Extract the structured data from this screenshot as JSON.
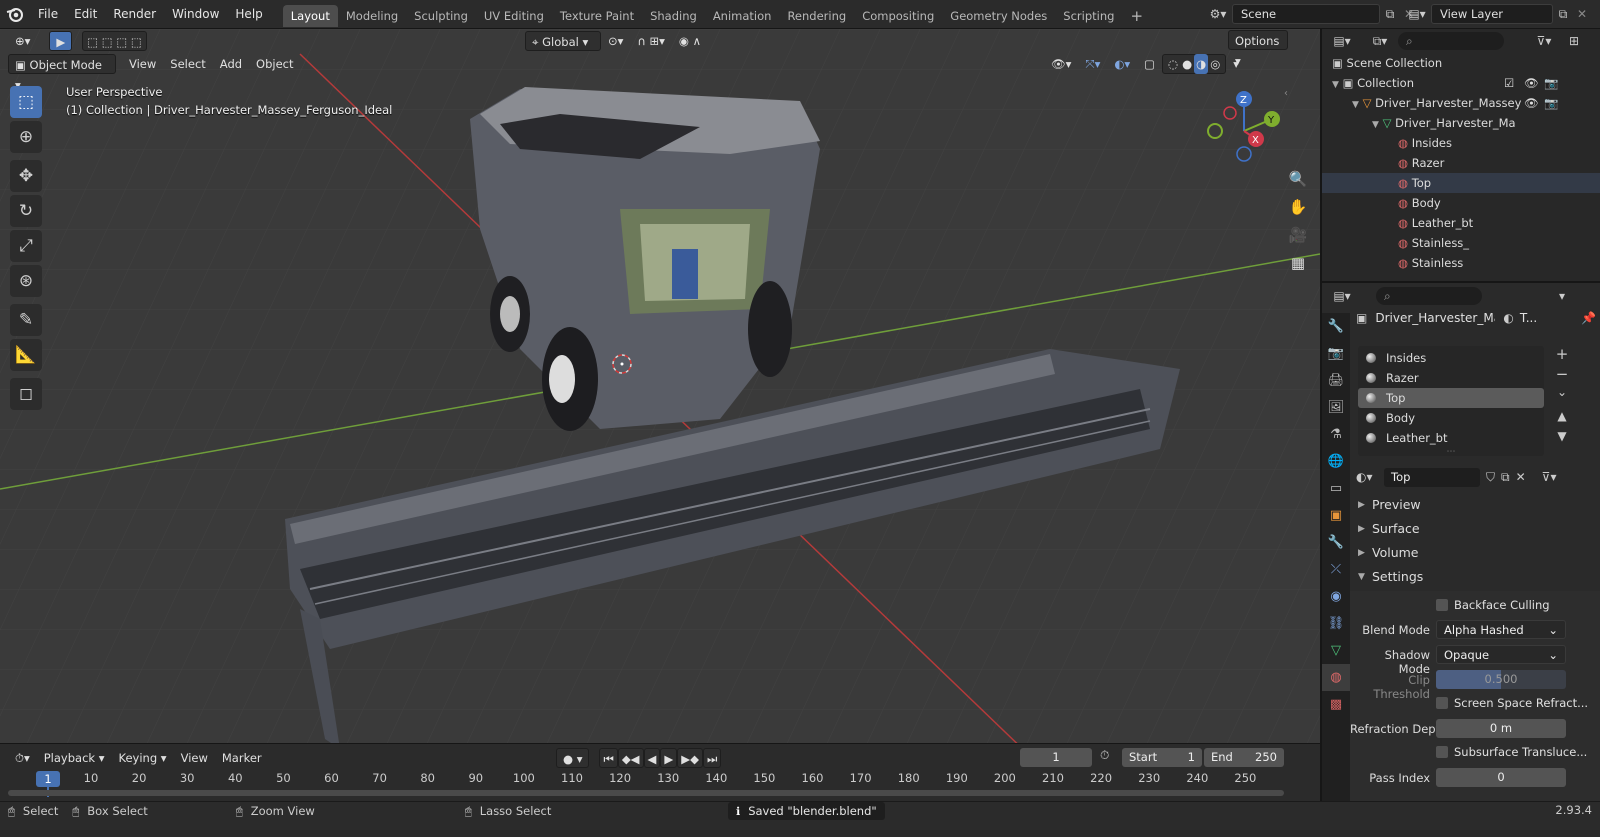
{
  "topbar": {
    "menus": [
      "File",
      "Edit",
      "Render",
      "Window",
      "Help"
    ],
    "workspaces": [
      "Layout",
      "Modeling",
      "Sculpting",
      "UV Editing",
      "Texture Paint",
      "Shading",
      "Animation",
      "Rendering",
      "Compositing",
      "Geometry Nodes",
      "Scripting"
    ],
    "active_workspace": "Layout",
    "scene": "Scene",
    "view_layer": "View Layer"
  },
  "viewport": {
    "mode": "Object Mode",
    "menus": [
      "View",
      "Select",
      "Add",
      "Object"
    ],
    "transform_orientation": "Global",
    "options_label": "Options",
    "perspective_label": "User Perspective",
    "collection_label": "(1) Collection | Driver_Harvester_Massey_Ferguson_Ideal",
    "gizmo": {
      "z": "Z",
      "y": "Y",
      "x": "X"
    }
  },
  "outliner": {
    "rows": [
      {
        "label": "Scene Collection",
        "indent": 0
      },
      {
        "label": "Collection",
        "indent": 1
      },
      {
        "label": "Driver_Harvester_Massey",
        "indent": 2
      },
      {
        "label": "Driver_Harvester_Ma",
        "indent": 3
      },
      {
        "label": "Insides",
        "indent": 4
      },
      {
        "label": "Razer",
        "indent": 4
      },
      {
        "label": "Top",
        "indent": 4
      },
      {
        "label": "Body",
        "indent": 4
      },
      {
        "label": "Leather_bt",
        "indent": 4
      },
      {
        "label": "Stainless_",
        "indent": 4
      },
      {
        "label": "Stainless",
        "indent": 4
      }
    ]
  },
  "properties": {
    "object_name": "Driver_Harvester_Ma...",
    "material_short": "T...",
    "material_slots": [
      "Insides",
      "Razer",
      "Top",
      "Body",
      "Leather_bt"
    ],
    "selected_slot": "Top",
    "material_name": "Top",
    "panels": [
      "Preview",
      "Surface",
      "Volume",
      "Settings"
    ],
    "settings": {
      "backface_culling": "Backface Culling",
      "blend_mode_label": "Blend Mode",
      "blend_mode_value": "Alpha Hashed",
      "shadow_mode_label": "Shadow Mode",
      "shadow_mode_value": "Opaque",
      "clip_threshold_label": "Clip Threshold",
      "clip_threshold_value": "0.500",
      "ssr_label": "Screen Space Refract...",
      "refraction_depth_label": "Refraction Depth",
      "refraction_depth_value": "0 m",
      "subsurface_label": "Subsurface Translucе...",
      "pass_index_label": "Pass Index",
      "pass_index_value": "0"
    }
  },
  "timeline": {
    "menus": [
      "Playback",
      "Keying",
      "View",
      "Marker"
    ],
    "current_frame": "1",
    "start_label": "Start",
    "start_value": "1",
    "end_label": "End",
    "end_value": "250",
    "ticks": [
      "10",
      "20",
      "30",
      "40",
      "50",
      "60",
      "70",
      "80",
      "90",
      "100",
      "110",
      "120",
      "130",
      "140",
      "150",
      "160",
      "170",
      "180",
      "190",
      "200",
      "210",
      "220",
      "230",
      "240",
      "250"
    ],
    "playhead": "1"
  },
  "statusbar": {
    "select": "Select",
    "box_select": "Box Select",
    "zoom_view": "Zoom View",
    "lasso_select": "Lasso Select",
    "message": "Saved \"blender.blend\"",
    "version": "2.93.4"
  }
}
